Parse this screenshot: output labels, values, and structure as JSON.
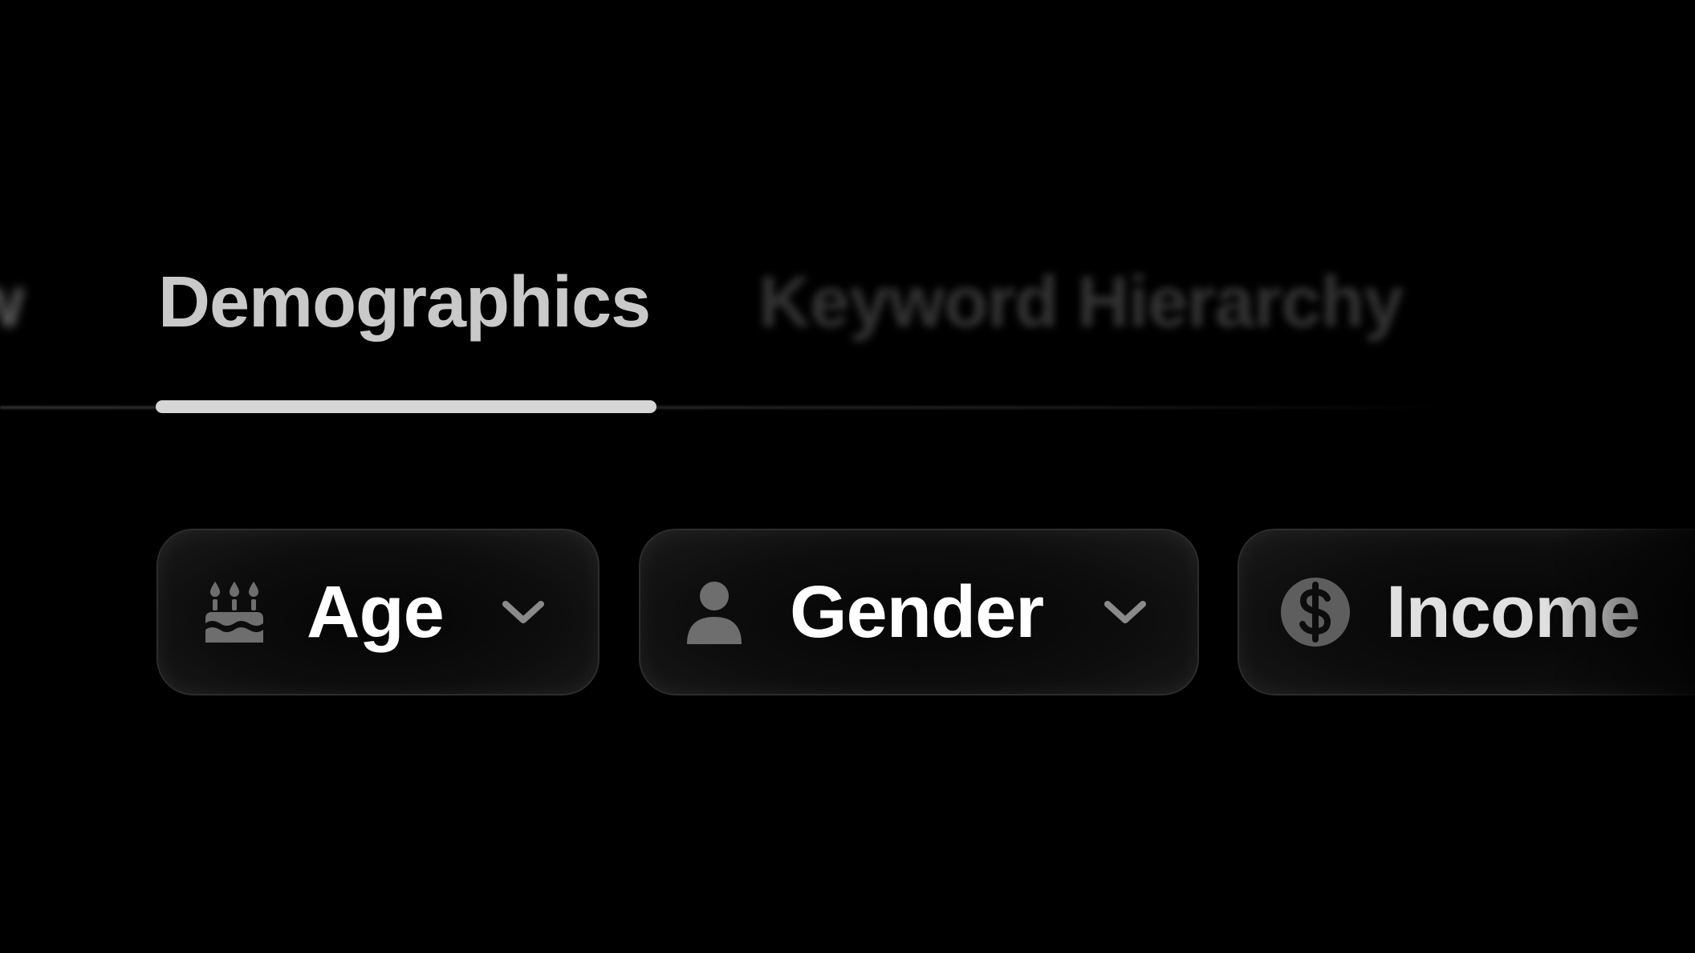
{
  "tabs": {
    "prev_partial": "w",
    "active": "Demographics",
    "next": "Keyword Hierarchy"
  },
  "filters": [
    {
      "label": "Age",
      "icon": "birthday-cake-icon",
      "has_dropdown": true
    },
    {
      "label": "Gender",
      "icon": "person-icon",
      "has_dropdown": true
    },
    {
      "label": "Income",
      "icon": "dollar-coin-icon",
      "has_dropdown": false
    }
  ],
  "colors": {
    "background": "#000000",
    "active_tab_text": "#c9c9c9",
    "tab_indicator": "#d6d6d6",
    "chip_border": "#2c2c2c",
    "chip_label": "#ffffff",
    "icon_gray": "#6e6e6e"
  }
}
